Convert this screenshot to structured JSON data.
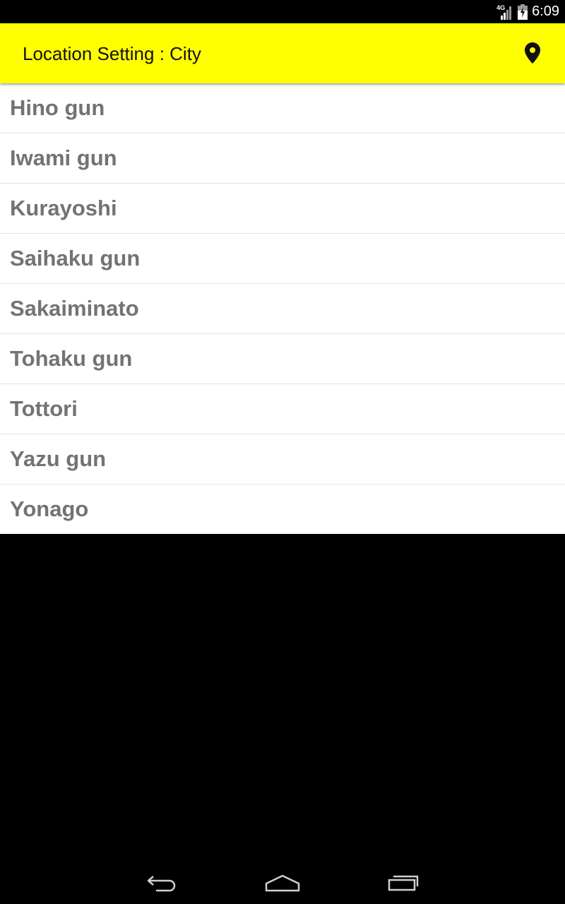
{
  "status_bar": {
    "network_type": "4G",
    "time": "6:09"
  },
  "app_bar": {
    "title": "Location Setting : City",
    "action_icon": "location-pin-icon"
  },
  "cities": [
    "Hino gun",
    "Iwami gun",
    "Kurayoshi",
    "Saihaku gun",
    "Sakaiminato",
    "Tohaku gun",
    "Tottori",
    "Yazu gun",
    "Yonago"
  ],
  "nav_bar": {
    "back_icon": "back-icon",
    "home_icon": "home-icon",
    "recents_icon": "recents-icon"
  },
  "colors": {
    "app_bar_background": "#ffff00",
    "list_text": "#737373",
    "divider": "#e3e3e3",
    "background": "#000000"
  }
}
